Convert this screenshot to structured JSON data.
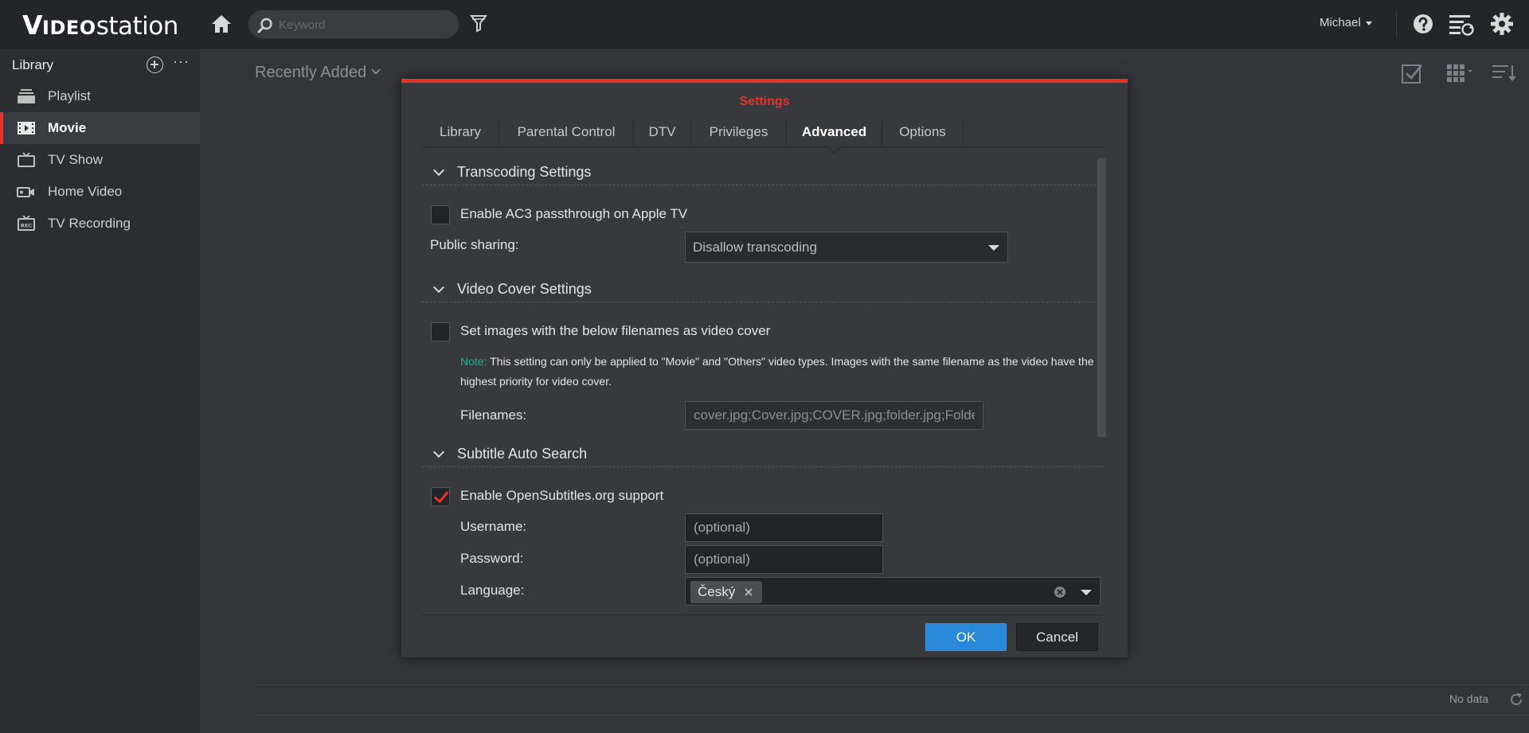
{
  "app": {
    "logo_video": "V",
    "logo_ideo": "IDEO",
    "logo_station": "station",
    "search_placeholder": "Keyword",
    "user": "Michael"
  },
  "sidebar": {
    "title": "Library",
    "items": [
      {
        "label": "Playlist",
        "icon": "playlist-icon"
      },
      {
        "label": "Movie",
        "icon": "movie-icon",
        "active": true
      },
      {
        "label": "TV Show",
        "icon": "tv-icon"
      },
      {
        "label": "Home Video",
        "icon": "camera-icon"
      },
      {
        "label": "TV Recording",
        "icon": "recording-icon"
      }
    ]
  },
  "main": {
    "breadcrumb": "Recently Added",
    "status": "No data"
  },
  "dialog": {
    "title": "Settings",
    "tabs": [
      "Library",
      "Parental Control",
      "DTV",
      "Privileges",
      "Advanced",
      "Options"
    ],
    "active_tab": "Advanced",
    "sections": {
      "transcoding": {
        "title": "Transcoding Settings",
        "ac3_label": "Enable AC3 passthrough on Apple TV",
        "ac3_checked": false,
        "public_sharing_label": "Public sharing:",
        "public_sharing_value": "Disallow transcoding"
      },
      "cover": {
        "title": "Video Cover Settings",
        "cover_label": "Set images with the below filenames as video cover",
        "cover_checked": false,
        "note_tag": "Note:",
        "note_text": " This setting can only be applied to \"Movie\" and \"Others\" video types. Images with the same filename as the video have the highest priority for video cover.",
        "filenames_label": "Filenames:",
        "filenames_value": "cover.jpg;Cover.jpg;COVER.jpg;folder.jpg;Folder.jpg"
      },
      "subtitle": {
        "title": "Subtitle Auto Search",
        "opensub_label": "Enable OpenSubtitles.org support",
        "opensub_checked": true,
        "username_label": "Username:",
        "username_placeholder": "(optional)",
        "password_label": "Password:",
        "password_placeholder": "(optional)",
        "language_label": "Language:",
        "language_tag": "Český"
      }
    },
    "ok": "OK",
    "cancel": "Cancel"
  },
  "colors": {
    "accent": "#e2332f",
    "primary_button": "#2a88d8",
    "note": "#1fb28a"
  }
}
